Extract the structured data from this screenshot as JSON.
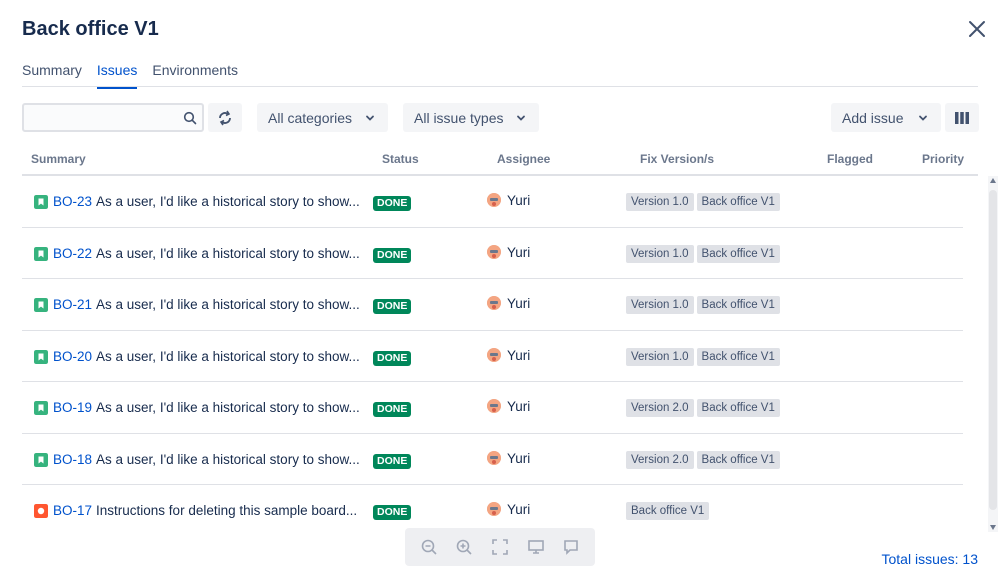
{
  "dialog": {
    "title": "Back office V1"
  },
  "tabs": [
    {
      "label": "Summary"
    },
    {
      "label": "Issues"
    },
    {
      "label": "Environments"
    }
  ],
  "filters": {
    "search_placeholder": "",
    "categories_label": "All categories",
    "issue_types_label": "All issue types",
    "add_issue_label": "Add issue"
  },
  "table": {
    "headers": {
      "summary": "Summary",
      "status": "Status",
      "assignee": "Assignee",
      "fix_versions": "Fix Version/s",
      "flagged": "Flagged",
      "priority": "Priority"
    },
    "rows": [
      {
        "type": "story",
        "key": "BO-23",
        "summary": "As a user, I'd like a historical story to show...",
        "status": "DONE",
        "assignee": "Yuri",
        "versions": [
          "Version 1.0",
          "Back office V1"
        ]
      },
      {
        "type": "story",
        "key": "BO-22",
        "summary": "As a user, I'd like a historical story to show...",
        "status": "DONE",
        "assignee": "Yuri",
        "versions": [
          "Version 1.0",
          "Back office V1"
        ]
      },
      {
        "type": "story",
        "key": "BO-21",
        "summary": "As a user, I'd like a historical story to show...",
        "status": "DONE",
        "assignee": "Yuri",
        "versions": [
          "Version 1.0",
          "Back office V1"
        ]
      },
      {
        "type": "story",
        "key": "BO-20",
        "summary": "As a user, I'd like a historical story to show...",
        "status": "DONE",
        "assignee": "Yuri",
        "versions": [
          "Version 1.0",
          "Back office V1"
        ]
      },
      {
        "type": "story",
        "key": "BO-19",
        "summary": "As a user, I'd like a historical story to show...",
        "status": "DONE",
        "assignee": "Yuri",
        "versions": [
          "Version 2.0",
          "Back office V1"
        ]
      },
      {
        "type": "story",
        "key": "BO-18",
        "summary": "As a user, I'd like a historical story to show...",
        "status": "DONE",
        "assignee": "Yuri",
        "versions": [
          "Version 2.0",
          "Back office V1"
        ]
      },
      {
        "type": "bug",
        "key": "BO-17",
        "summary": "Instructions for deleting this sample board...",
        "status": "DONE",
        "assignee": "Yuri",
        "versions": [
          "Back office V1"
        ]
      }
    ]
  },
  "footer": {
    "total": "Total issues: 13"
  },
  "colors": {
    "accent": "#0052cc",
    "done": "#00875a",
    "story": "#36b37e",
    "bug": "#ff5630"
  },
  "icons": {
    "close": "close-icon",
    "search": "search-icon",
    "refresh": "refresh-icon",
    "chevron": "chevron-down-icon",
    "columns": "columns-icon",
    "story": "story-icon",
    "bug": "bug-icon",
    "zoom_out": "zoom-out-icon",
    "zoom_in": "zoom-in-icon",
    "fullscreen": "fullscreen-icon",
    "present": "present-icon",
    "comment": "comment-icon"
  }
}
